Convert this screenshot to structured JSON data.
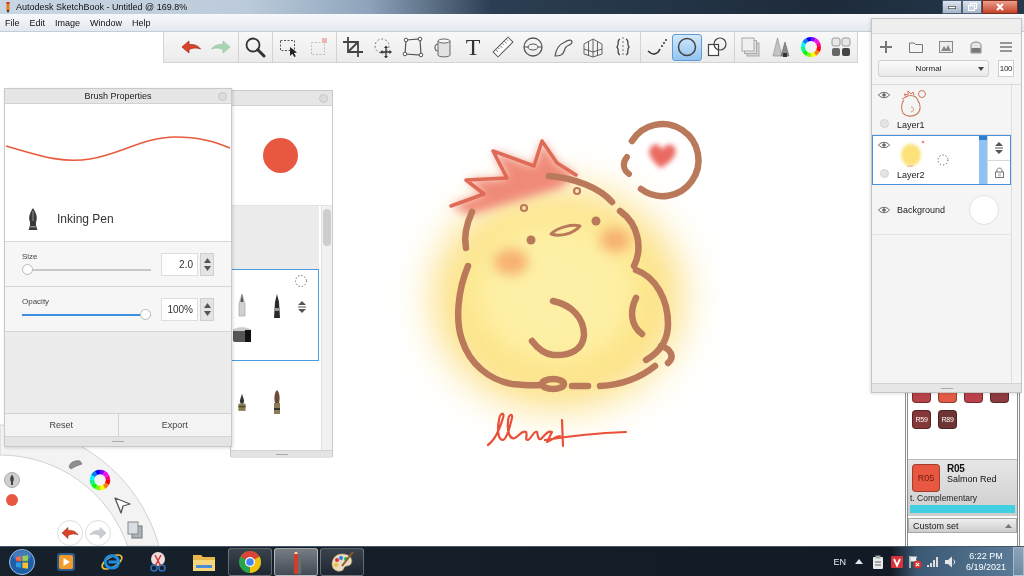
{
  "window": {
    "title": "Autodesk SketchBook - Untitled @ 169.8%"
  },
  "menu": [
    "File",
    "Edit",
    "Image",
    "Window",
    "Help"
  ],
  "toolbar": {
    "groups": [
      [
        {
          "kind": "undo",
          "selected": false,
          "disabled": false
        },
        {
          "kind": "redo",
          "selected": false,
          "disabled": true
        }
      ],
      [
        {
          "kind": "zoom",
          "selected": false,
          "disabled": false
        }
      ],
      [
        {
          "kind": "select",
          "selected": false,
          "disabled": false
        },
        {
          "kind": "transform",
          "selected": false,
          "disabled": true
        }
      ],
      [
        {
          "kind": "crop",
          "selected": false,
          "disabled": false
        },
        {
          "kind": "move",
          "selected": false,
          "disabled": false
        },
        {
          "kind": "distort",
          "selected": false,
          "disabled": false
        },
        {
          "kind": "fill",
          "selected": false,
          "disabled": false
        },
        {
          "kind": "text",
          "glyph": "T",
          "selected": false,
          "disabled": false
        },
        {
          "kind": "ruler",
          "selected": false,
          "disabled": false
        },
        {
          "kind": "ellipseguide",
          "selected": false,
          "disabled": false
        },
        {
          "kind": "curve",
          "selected": false,
          "disabled": false
        },
        {
          "kind": "perspective",
          "selected": false,
          "disabled": false
        },
        {
          "kind": "symmetry",
          "selected": false,
          "disabled": false
        }
      ],
      [
        {
          "kind": "stroke",
          "selected": false,
          "disabled": false
        },
        {
          "kind": "ellipse",
          "selected": true,
          "disabled": false
        },
        {
          "kind": "shape",
          "selected": false,
          "disabled": false
        }
      ],
      [
        {
          "kind": "copy",
          "selected": false,
          "disabled": false
        },
        {
          "kind": "brushes",
          "selected": false,
          "disabled": false
        },
        {
          "kind": "color",
          "selected": false,
          "disabled": false
        },
        {
          "kind": "swatches",
          "selected": false,
          "disabled": false
        }
      ]
    ]
  },
  "brush_library": {
    "sets": [
      {
        "selected": true
      },
      {
        "selected": false
      }
    ]
  },
  "brush_properties": {
    "title": "Brush Properties",
    "brush_name": "Inking Pen",
    "sliders": [
      {
        "label": "Size",
        "value": "2.0",
        "level": 0.0
      },
      {
        "label": "Opacity",
        "value": "100%",
        "level": 1.0
      }
    ],
    "buttons": [
      "Reset",
      "Export"
    ]
  },
  "lagoon": {
    "items": [
      {
        "kind": "undo",
        "disabled": false
      },
      {
        "kind": "redo",
        "disabled": true
      }
    ]
  },
  "layers": {
    "blend_mode": "Normal",
    "opacity": "100",
    "items": [
      {
        "name": "Layer1",
        "kind": "ink",
        "visible": true,
        "selected": false
      },
      {
        "name": "Layer2",
        "kind": "fill",
        "visible": true,
        "selected": true
      },
      {
        "name": "Background",
        "kind": "background",
        "visible": true,
        "selected": false
      }
    ]
  },
  "copic": {
    "swatches": [
      {
        "color": "#b7424a"
      },
      {
        "color": "#e15b45"
      },
      {
        "color": "#ba414b"
      },
      {
        "color": "#8d3b40"
      },
      {
        "code": "R59",
        "color": "#853838"
      },
      {
        "code": "R89",
        "color": "#6f3534"
      }
    ],
    "current": {
      "swatch_code": "R05",
      "code": "R05",
      "name": "Salmon Red",
      "color": "#e8573f"
    },
    "complementary": "t. Complementary",
    "set": "Custom set"
  },
  "taskbar": {
    "apps": [
      {
        "kind": "player",
        "running": false,
        "selected": false
      },
      {
        "kind": "ie",
        "running": false,
        "selected": false
      },
      {
        "kind": "snip",
        "running": false,
        "selected": false
      },
      {
        "kind": "files",
        "running": false,
        "selected": false
      },
      {
        "kind": "chrome",
        "running": true,
        "selected": false
      },
      {
        "kind": "sketch",
        "running": true,
        "selected": true
      },
      {
        "kind": "paint",
        "running": true,
        "selected": false
      }
    ],
    "language": "EN",
    "time": "6:22 PM",
    "date": "6/19/2021"
  }
}
